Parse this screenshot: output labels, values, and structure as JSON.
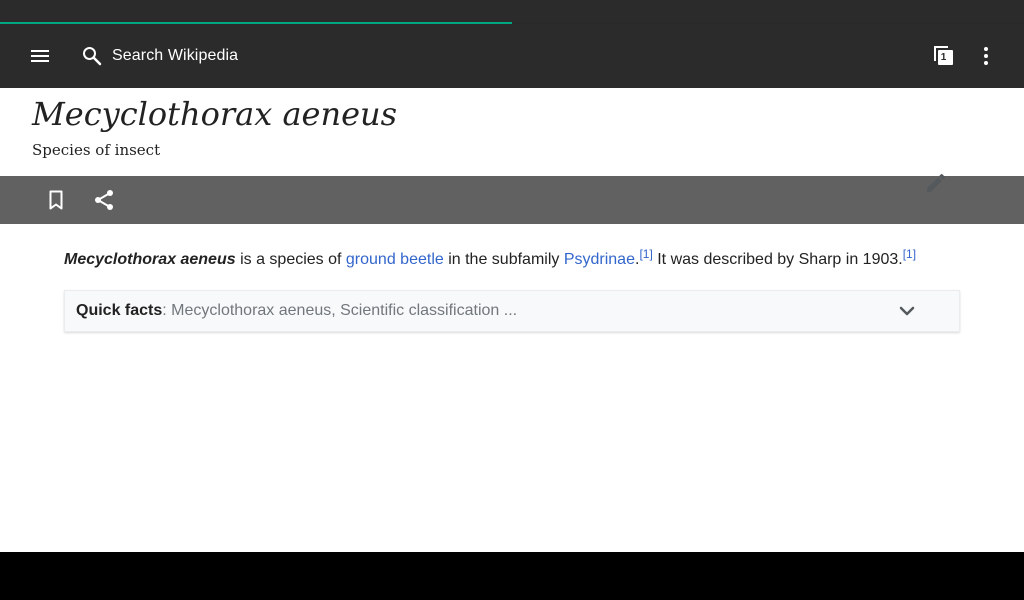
{
  "toolbar": {
    "search_placeholder": "Search Wikipedia",
    "tabs_count": "1",
    "icons": [
      "menu-icon",
      "search-icon",
      "tabs-icon",
      "overflow-icon"
    ]
  },
  "page_load_progress": 0.5,
  "article": {
    "title": "Mecyclothorax aeneus",
    "description": "Species of insect",
    "actions": [
      "bookmark-icon",
      "share-icon",
      "edit-icon"
    ],
    "lead": {
      "bold_name": "Mecyclothorax aeneus",
      "text1": " is a species of ",
      "link1": "ground beetle",
      "text2": " in the subfamily ",
      "link2": "Psydrinae",
      "text3": ".",
      "ref1": "[1]",
      "text4": " It was described by Sharp in 1903.",
      "ref2": "[1]"
    },
    "quick_facts": {
      "label": "Quick facts",
      "summary": ": Mecyclothorax aeneus, Scientific classification ..."
    }
  },
  "colors": {
    "toolbar": "#2b2b2b",
    "progress": "#00af89",
    "action_bar": "#616161",
    "link": "#3366cc"
  }
}
